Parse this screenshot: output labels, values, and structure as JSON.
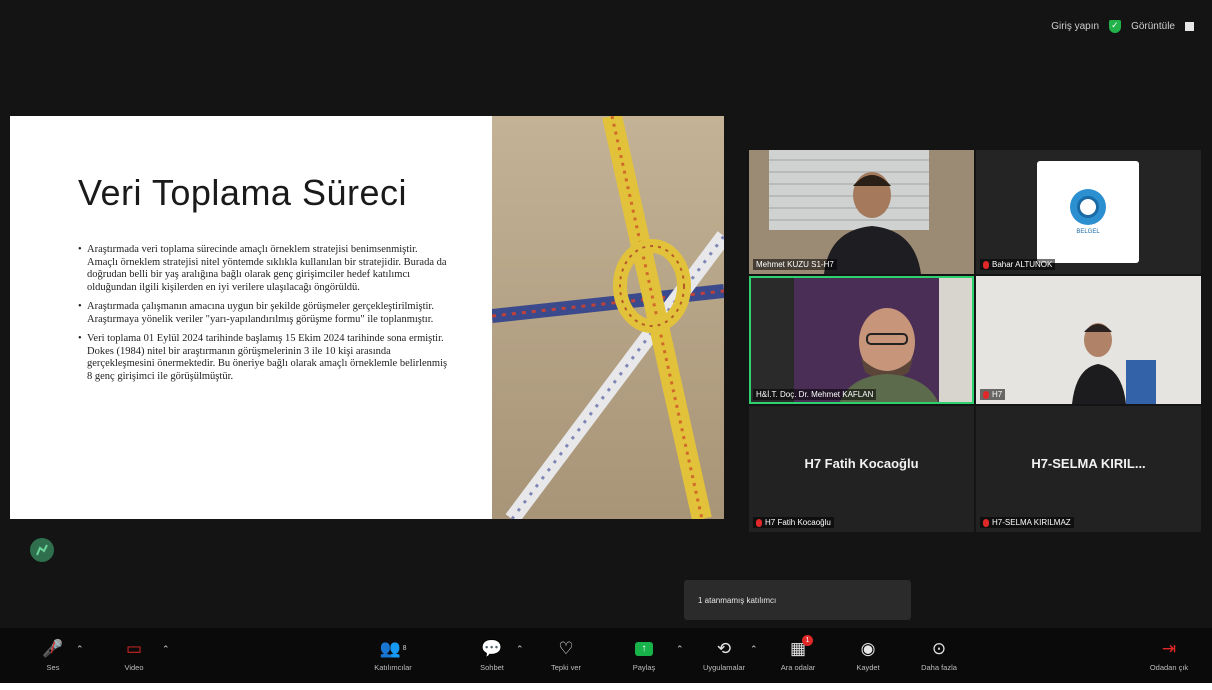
{
  "top_right": {
    "signin_label": "Giriş yapın",
    "view_label": "Görüntüle"
  },
  "slide": {
    "title": "Veri Toplama Süreci",
    "bullets": [
      "Araştırmada veri toplama sürecinde amaçlı örneklem stratejisi benimsenmiştir. Amaçlı örneklem stratejisi nitel yöntemde sıklıkla kullanılan bir stratejidir. Burada da doğrudan belli bir yaş aralığına bağlı olarak genç girişimciler hedef katılımcı olduğundan ilgili kişilerden en iyi verilere ulaşılacağı öngörüldü.",
      "Araştırmada çalışmanın amacına uygun bir şekilde görüşmeler gerçekleştirilmiştir. Araştırmaya yönelik veriler \"yarı-yapılandırılmış görüşme formu\" ile toplanmıştır.",
      "Veri toplama 01 Eylül 2024 tarihinde başlamış 15 Ekim 2024 tarihinde sona ermiştir. Dokes (1984) nitel bir araştırmanın görüşmelerinin 3 ile 10 kişi arasında gerçekleşmesini önermektedir. Bu öneriye bağlı olarak amaçlı örneklemle belirlenmiş 8 genç girişimci ile görüşülmüştür."
    ]
  },
  "participants": {
    "p1": {
      "label": "Mehmet KUZU S1-H7"
    },
    "p2": {
      "label": "Bahar ALTUNOK",
      "logo_text": "BELGEL"
    },
    "p3": {
      "label": "H&İ.T. Doç. Dr. Mehmet KAFLAN"
    },
    "p4": {
      "label": "H7"
    },
    "p5": {
      "display_name": "H7 Fatih Kocaoğlu",
      "label": "H7 Fatih Kocaoğlu"
    },
    "p6": {
      "display_name": "H7-SELMA KIRIL...",
      "label": "H7-SELMA KIRILMAZ"
    }
  },
  "tooltip": {
    "text": "1 atanmamış katılımcı"
  },
  "toolbar": {
    "audio": "Ses",
    "video": "Video",
    "participants": "Katılımcılar",
    "participants_count": "8",
    "chat": "Sohbet",
    "reactions": "Tepki ver",
    "share": "Paylaş",
    "apps": "Uygulamalar",
    "breakout": "Ara odalar",
    "breakout_badge": "1",
    "record": "Kaydet",
    "more": "Daha fazla",
    "leave": "Odadan çık"
  },
  "colors": {
    "accent_green": "#21b24a",
    "speaker_outline": "#2fd16e",
    "mute_red": "#e02828"
  },
  "icons": [
    "shield-check-icon",
    "grid-view-icon",
    "mic-muted-icon",
    "video-off-icon",
    "participants-icon",
    "chat-icon",
    "heart-icon",
    "share-screen-icon",
    "apps-icon",
    "breakout-rooms-icon",
    "record-icon",
    "more-icon",
    "leave-icon"
  ]
}
